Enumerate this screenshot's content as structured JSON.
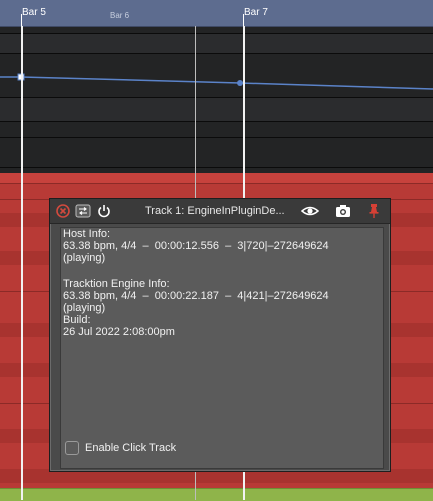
{
  "ruler": {
    "markers": [
      {
        "label": "Bar 5",
        "kind": "major"
      },
      {
        "label": "Bar 6",
        "kind": "minor"
      },
      {
        "label": "Bar 7",
        "kind": "major"
      }
    ]
  },
  "plugin_window": {
    "title": "Track 1: EngineInPluginDe...",
    "icons": [
      "close-icon",
      "bypass-icon",
      "power-icon",
      "eye-icon",
      "camera-icon",
      "pin-icon"
    ],
    "host_info": {
      "heading": "Host Info:",
      "line1": "63.38 bpm, 4/4  –  00:00:12.556  –  3|720|–272649624",
      "line2": "(playing)"
    },
    "engine_info": {
      "heading": "Tracktion Engine Info:",
      "line1": "63.38 bpm, 4/4  –  00:00:22.187  –  4|421|–272649624",
      "line2": "(playing)",
      "build_heading": "Build:",
      "build_value": "26 Jul 2022 2:08:00pm"
    },
    "click_track": {
      "label": "Enable Click Track",
      "checked": false
    }
  },
  "colors": {
    "ruler": "#5d6c8f",
    "clip": "#b83a36",
    "automation_line": "#5b83c9",
    "bottom_clip": "#8fb44a"
  }
}
